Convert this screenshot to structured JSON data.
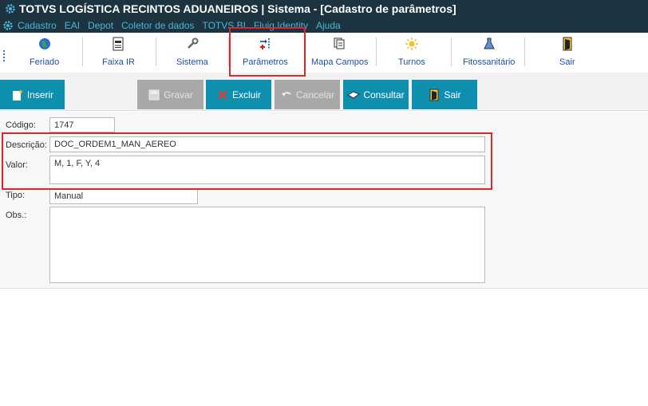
{
  "window": {
    "title": "TOTVS LOGÍSTICA RECINTOS ADUANEIROS | Sistema - [Cadastro de parâmetros]"
  },
  "menu": [
    "Cadastro",
    "EAI",
    "Depot",
    "Coletor de dados",
    "TOTVS BI",
    "Fluig Identity",
    "Ajuda"
  ],
  "toolbar": [
    {
      "label": "Feriado",
      "icon": "globe-icon"
    },
    {
      "label": "Faixa IR",
      "icon": "document-pdf-icon"
    },
    {
      "label": "Sistema",
      "icon": "wrench-icon"
    },
    {
      "label": "Parâmetros",
      "icon": "parameters-icon"
    },
    {
      "label": "Mapa Campos",
      "icon": "document-stack-icon"
    },
    {
      "label": "Turnos",
      "icon": "sun-icon"
    },
    {
      "label": "Fitossanitário",
      "icon": "flask-icon"
    },
    {
      "label": "Sair",
      "icon": "door-exit-icon"
    }
  ],
  "actions": {
    "inserir": "Inserir",
    "gravar": "Gravar",
    "excluir": "Excluir",
    "cancelar": "Cancelar",
    "consultar": "Consultar",
    "sair": "Sair"
  },
  "form": {
    "codigo_label": "Código:",
    "codigo": "1747",
    "descricao_label": "Descrição:",
    "descricao": "DOC_ORDEM1_MAN_AEREO",
    "valor_label": "Valor:",
    "valor": "M, 1, F, Y, 4",
    "tipo_label": "Tipo:",
    "tipo": "Manual",
    "obs_label": "Obs.:",
    "obs": ""
  },
  "colors": {
    "titlebar": "#1b3440",
    "menu_text": "#4fb3d9",
    "action_button": "#0e8fb0",
    "highlight": "#e0242c"
  }
}
